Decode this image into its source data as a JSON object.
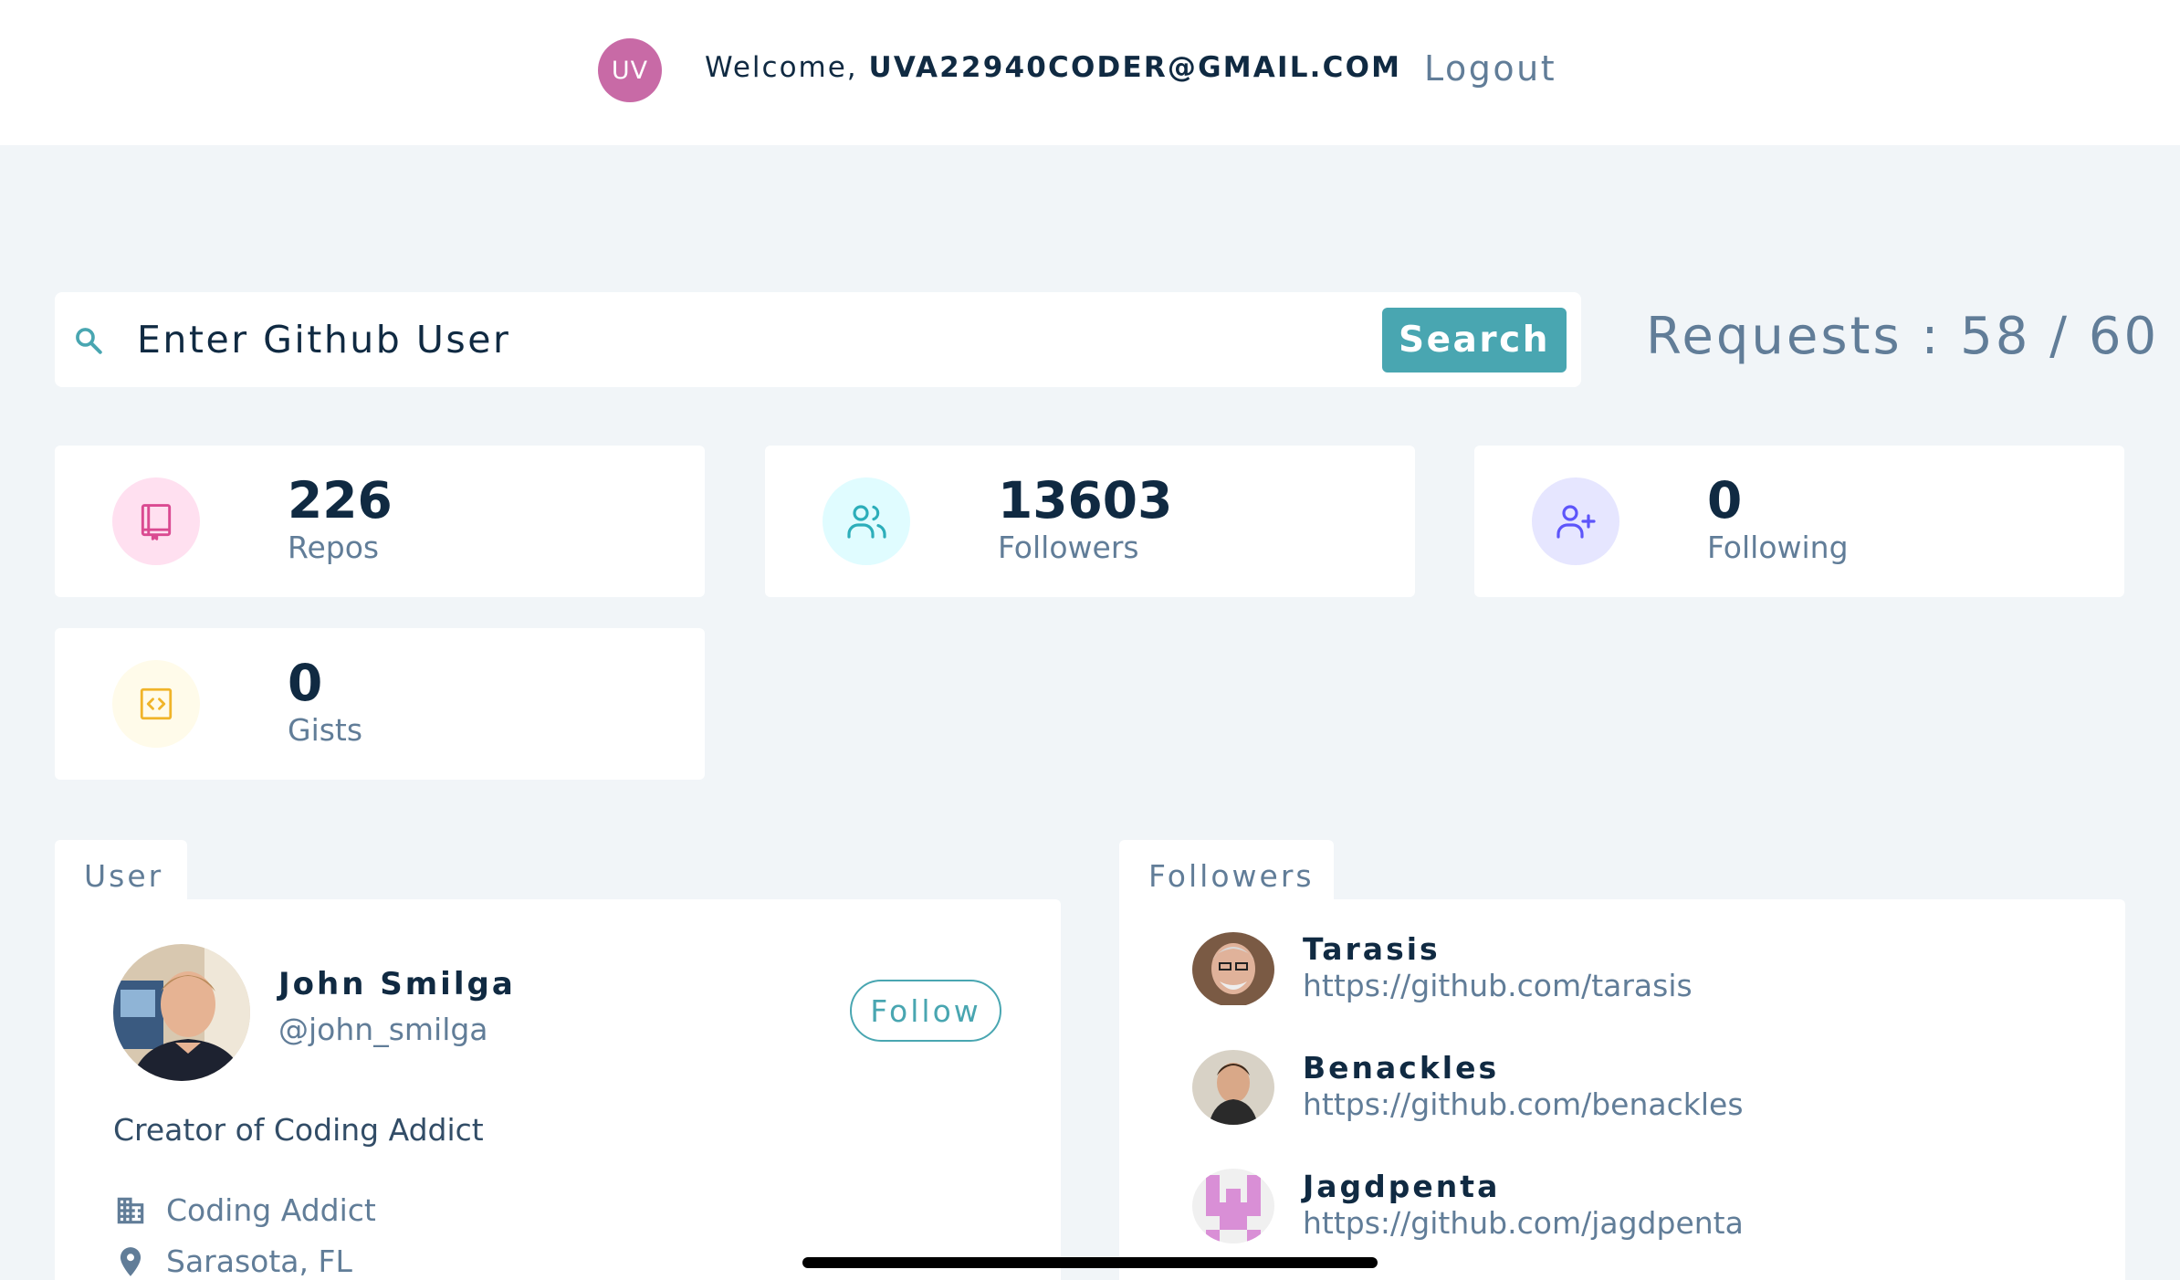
{
  "navbar": {
    "avatar_initials": "UV",
    "welcome_prefix": "Welcome, ",
    "user_email": "UVA22940CODER@GMAIL.COM",
    "logout_label": "Logout"
  },
  "search": {
    "placeholder": "Enter Github User",
    "button_label": "Search",
    "requests_text": "Requests : 58 / 60"
  },
  "stats": [
    {
      "value": "226",
      "label": "Repos",
      "icon": "book-icon",
      "color": "#da4a91",
      "bg": "#ffe0f0"
    },
    {
      "value": "13603",
      "label": "Followers",
      "icon": "users-icon",
      "color": "#2caeba",
      "bg": "#e0fcff"
    },
    {
      "value": "0",
      "label": "Following",
      "icon": "user-plus-icon",
      "color": "#5d55fa",
      "bg": "#e6e6ff"
    },
    {
      "value": "0",
      "label": "Gists",
      "icon": "code-icon",
      "color": "#f0b429",
      "bg": "#fffbea"
    }
  ],
  "user_panel": {
    "tab_label": "User",
    "name": "John Smilga",
    "handle": "@john_smilga",
    "follow_label": "Follow",
    "bio": "Creator of Coding Addict",
    "company": "Coding Addict",
    "location": "Sarasota, FL"
  },
  "followers_panel": {
    "tab_label": "Followers",
    "items": [
      {
        "name": "Tarasis",
        "url": "https://github.com/tarasis"
      },
      {
        "name": "Benackles",
        "url": "https://github.com/benackles"
      },
      {
        "name": "Jagdpenta",
        "url": "https://github.com/jagdpenta"
      }
    ]
  }
}
